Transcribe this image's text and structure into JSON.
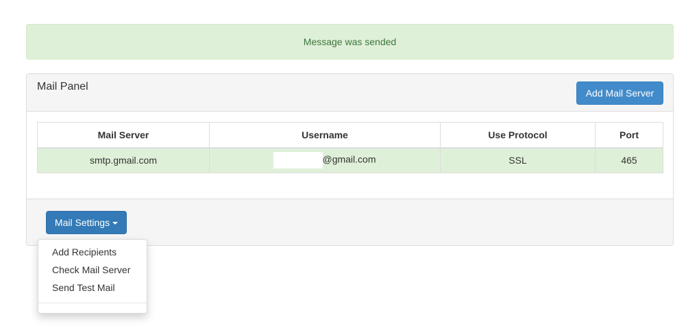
{
  "alert": {
    "message": "Message was sended"
  },
  "panel": {
    "title": "Mail Panel",
    "add_button_label": "Add Mail Server",
    "table": {
      "headers": [
        "Mail Server",
        "Username",
        "Use Protocol",
        "Port"
      ],
      "rows": [
        {
          "mail_server": "smtp.gmail.com",
          "username_suffix": "@gmail.com",
          "protocol": "SSL",
          "port": "465"
        }
      ]
    },
    "settings_button_label": "Mail Settings"
  },
  "dropdown": {
    "items": [
      "Add Recipients",
      "Check Mail Server",
      "Send Test Mail"
    ]
  },
  "colors": {
    "success_bg": "#dff0d8",
    "success_text": "#3c763d",
    "primary": "#337ab7",
    "info_primary": "#428bca"
  }
}
